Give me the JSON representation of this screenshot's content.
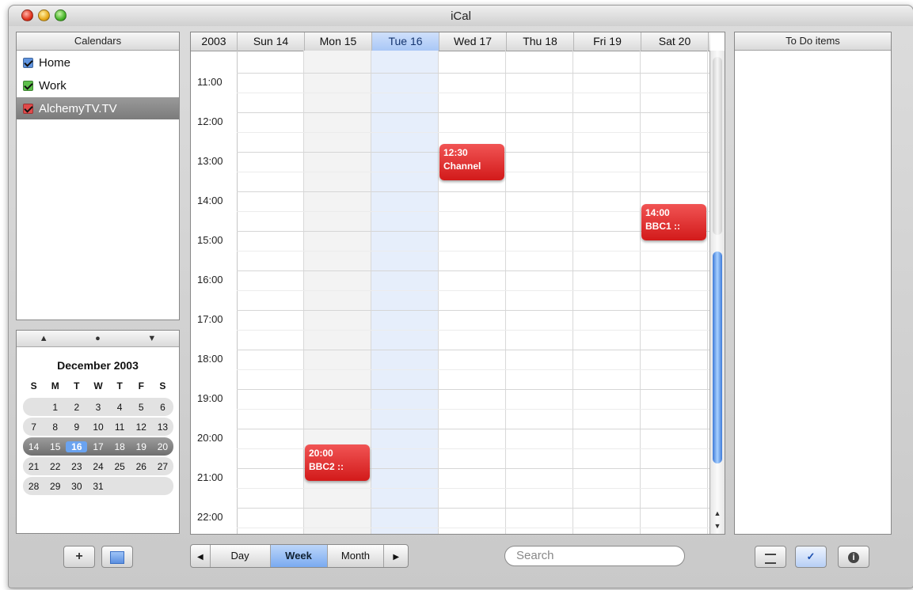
{
  "window": {
    "title": "iCal"
  },
  "calendars": {
    "header": "Calendars",
    "items": [
      {
        "label": "Home",
        "color": "#3d7bd8"
      },
      {
        "label": "Work",
        "color": "#3aa33a"
      },
      {
        "label": "AlchemyTV.TV",
        "color": "#d42a2a"
      }
    ]
  },
  "minimonth": {
    "nav": [
      "▲",
      "●",
      "▼"
    ],
    "title": "December 2003",
    "weekdays": [
      "S",
      "M",
      "T",
      "W",
      "T",
      "F",
      "S"
    ],
    "weeks": [
      [
        "",
        "1",
        "2",
        "3",
        "4",
        "5",
        "6"
      ],
      [
        "7",
        "8",
        "9",
        "10",
        "11",
        "12",
        "13"
      ],
      [
        "14",
        "15",
        "16",
        "17",
        "18",
        "19",
        "20"
      ],
      [
        "21",
        "22",
        "23",
        "24",
        "25",
        "26",
        "27"
      ],
      [
        "28",
        "29",
        "30",
        "31",
        "",
        "",
        ""
      ]
    ]
  },
  "week": {
    "year": "2003",
    "days": [
      "Sun 14",
      "Mon 15",
      "Tue 16",
      "Wed 17",
      "Thu 18",
      "Fri 19",
      "Sat 20"
    ],
    "times": [
      "11:00",
      "12:00",
      "13:00",
      "14:00",
      "15:00",
      "16:00",
      "17:00",
      "18:00",
      "19:00",
      "20:00",
      "21:00",
      "22:00"
    ],
    "events": [
      {
        "time": "12:30",
        "title": "Channel"
      },
      {
        "time": "14:00",
        "title": "BBC1 ::"
      },
      {
        "time": "20:00",
        "title": "BBC2 ::"
      }
    ]
  },
  "todo": {
    "header": "To Do items"
  },
  "toolbar": {
    "add": "+",
    "day": "Day",
    "week": "Week",
    "month": "Month",
    "prev": "◀",
    "next": "▶",
    "search_placeholder": "Search"
  }
}
